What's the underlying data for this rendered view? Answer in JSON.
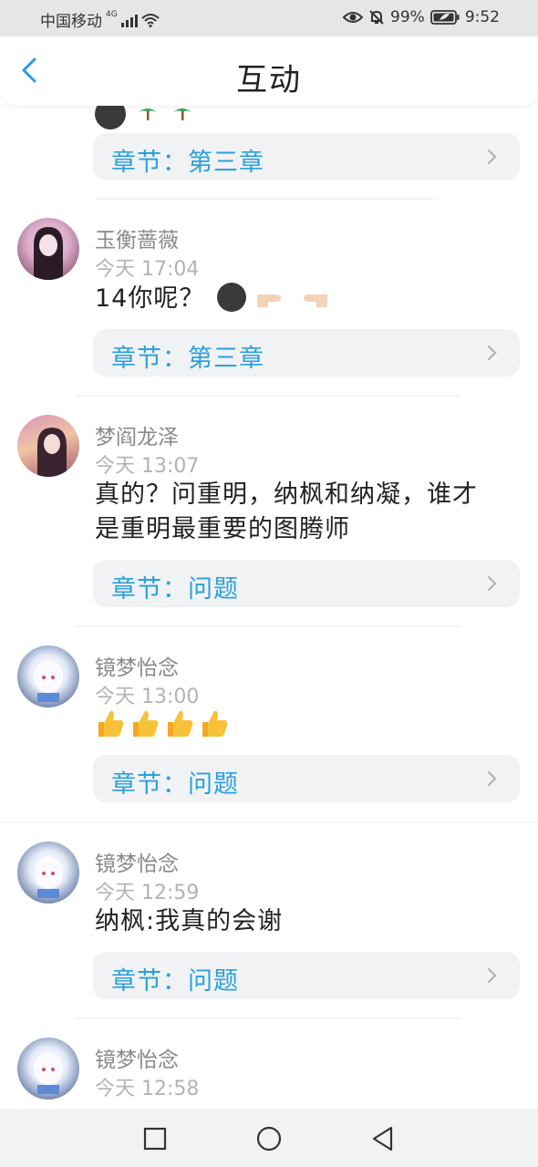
{
  "status_bar": {
    "carrier": "中国移动",
    "network": "4G",
    "battery": "99%",
    "time": "9:52"
  },
  "header": {
    "title": "互动"
  },
  "chapter_prefix": "章节：",
  "comments": [
    {
      "chapter": "第三章"
    },
    {
      "name": "玉衡蔷薇",
      "time": "今天 17:04",
      "content": "14你呢？",
      "chapter": "第三章"
    },
    {
      "name": "梦阎龙泽",
      "time": "今天 13:07",
      "content_line1": "真的？问重明，纳枫和纳凝，谁才",
      "content_line2": "是重明最重要的图腾师",
      "chapter": "问题"
    },
    {
      "name": "镜梦怡念",
      "time": "今天 13:00",
      "content": "",
      "chapter": "问题"
    },
    {
      "name": "镜梦怡念",
      "time": "今天 12:59",
      "content": "纳枫:我真的会谢",
      "chapter": "问题"
    },
    {
      "name": "镜梦怡念",
      "time": "今天 12:58"
    }
  ]
}
